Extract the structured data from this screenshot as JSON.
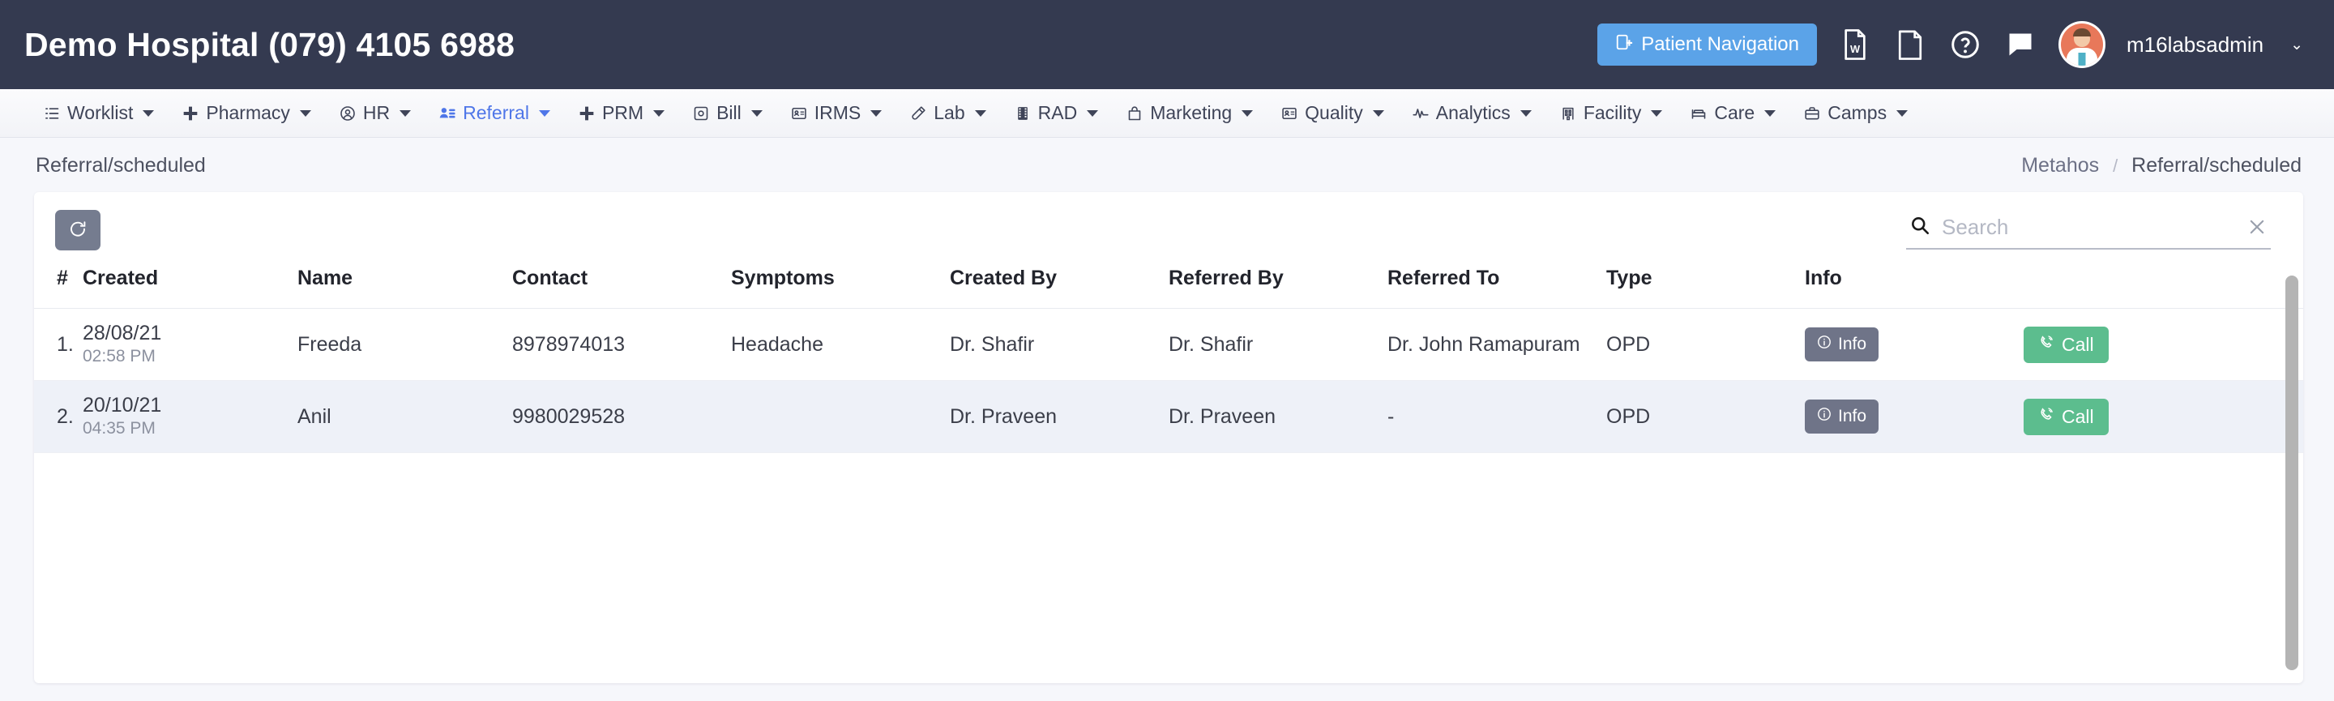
{
  "header": {
    "brand_title": "Demo Hospital (079) 4105 6988",
    "patient_nav_label": "Patient Navigation",
    "username": "m16labsadmin",
    "user_caret": "⌄",
    "icons": [
      {
        "name": "word-document-icon"
      },
      {
        "name": "file-icon"
      },
      {
        "name": "help-circle-icon"
      },
      {
        "name": "chat-bubble-icon"
      }
    ],
    "accent_blue": "#5ba3e8",
    "background": "#343a50"
  },
  "nav": {
    "items": [
      {
        "label": "Worklist",
        "icon": "list-icon",
        "active": false
      },
      {
        "label": "Pharmacy",
        "icon": "plus-icon",
        "active": false
      },
      {
        "label": "HR",
        "icon": "user-circle-icon",
        "active": false
      },
      {
        "label": "Referral",
        "icon": "user-list-icon",
        "active": true
      },
      {
        "label": "PRM",
        "icon": "plus-icon",
        "active": false
      },
      {
        "label": "Bill",
        "icon": "receipt-icon",
        "active": false
      },
      {
        "label": "IRMS",
        "icon": "id-card-icon",
        "active": false
      },
      {
        "label": "Lab",
        "icon": "test-tube-icon",
        "active": false
      },
      {
        "label": "RAD",
        "icon": "film-icon",
        "active": false
      },
      {
        "label": "Marketing",
        "icon": "bag-icon",
        "active": false
      },
      {
        "label": "Quality",
        "icon": "id-card-icon",
        "active": false
      },
      {
        "label": "Analytics",
        "icon": "pulse-icon",
        "active": false
      },
      {
        "label": "Facility",
        "icon": "building-icon",
        "active": false
      },
      {
        "label": "Care",
        "icon": "bed-icon",
        "active": false
      },
      {
        "label": "Camps",
        "icon": "briefcase-icon",
        "active": false
      }
    ],
    "active_color": "#4f76e8"
  },
  "page": {
    "title": "Referral/scheduled",
    "breadcrumb_root": "Metahos",
    "breadcrumb_sep": "/",
    "breadcrumb_current": "Referral/scheduled"
  },
  "toolbar": {
    "refresh_icon": "refresh-icon",
    "search_placeholder": "Search",
    "search_value": "",
    "search_icon": "search-icon",
    "clear_icon": "close-icon"
  },
  "table": {
    "columns": [
      "#",
      "Created",
      "Name",
      "Contact",
      "Symptoms",
      "Created By",
      "Referred By",
      "Referred To",
      "Type",
      "Info",
      ""
    ],
    "rows": [
      {
        "index": "1.",
        "created_date": "28/08/21",
        "created_time": "02:58 PM",
        "name": "Freeda",
        "contact": "8978974013",
        "symptoms": "Headache",
        "created_by": "Dr. Shafir",
        "referred_by": "Dr. Shafir",
        "referred_to": "Dr. John Ramapuram",
        "type": "OPD",
        "info_label": "Info",
        "call_label": "Call",
        "highlighted": false
      },
      {
        "index": "2.",
        "created_date": "20/10/21",
        "created_time": "04:35 PM",
        "name": "Anil",
        "contact": "9980029528",
        "symptoms": "",
        "created_by": "Dr. Praveen",
        "referred_by": "Dr. Praveen",
        "referred_to": "-",
        "type": "OPD",
        "info_label": "Info",
        "call_label": "Call",
        "highlighted": true
      }
    ],
    "info_button_color": "#6f7488",
    "call_button_color": "#5cbd8e",
    "row_highlight_color": "#eef1f8"
  }
}
